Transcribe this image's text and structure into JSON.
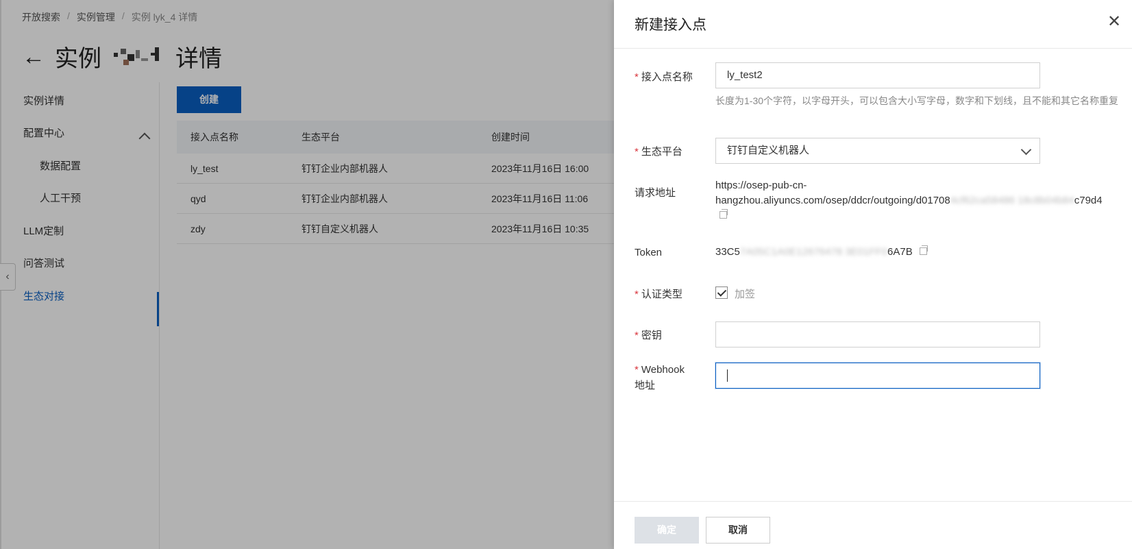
{
  "breadcrumb": {
    "items": [
      "开放搜索",
      "实例管理"
    ],
    "current": "实例 lyk_4 详情"
  },
  "header": {
    "title_prefix": "实例",
    "title_suffix": "详情"
  },
  "sidebar": {
    "items": [
      {
        "label": "实例详情"
      },
      {
        "label": "配置中心"
      },
      {
        "label": "数据配置"
      },
      {
        "label": "人工干预"
      },
      {
        "label": "LLM定制"
      },
      {
        "label": "问答测试"
      },
      {
        "label": "生态对接"
      }
    ]
  },
  "main": {
    "create_label": "创建",
    "columns": [
      "接入点名称",
      "生态平台",
      "创建时间"
    ],
    "rows": [
      {
        "name": "ly_test",
        "platform": "钉钉企业内部机器人",
        "time": "2023年11月16日 16:00"
      },
      {
        "name": "qyd",
        "platform": "钉钉企业内部机器人",
        "time": "2023年11月16日 11:06"
      },
      {
        "name": "zdy",
        "platform": "钉钉自定义机器人",
        "time": "2023年11月16日 10:35"
      }
    ]
  },
  "drawer": {
    "title": "新建接入点",
    "close_symbol": "✕",
    "fields": {
      "name_label": "接入点名称",
      "name_value": "ly_test2",
      "name_hint": "长度为1-30个字符，以字母开头，可以包含大小写字母，数字和下划线，且不能和其它名称重复",
      "platform_label": "生态平台",
      "platform_value": "钉钉自定义机器人",
      "url_label": "请求地址",
      "url_line1": "https://osep-pub-cn-",
      "url_line2_visible": "hangzhou.aliyuncs.com/osep/ddcr/outgoing/d01708",
      "url_line2_tail": "c79d4",
      "token_label": "Token",
      "token_start": "33C5",
      "token_end": "6A7B",
      "auth_label": "认证类型",
      "auth_option": "加签",
      "secret_label": "密钥",
      "webhook_label_1": "Webhook",
      "webhook_label_2": "地址"
    },
    "ok_label": "确定",
    "cancel_label": "取消"
  },
  "colors": {
    "primary": "#0a5fc2",
    "required": "#d9363e",
    "disabled": "#dde1e6"
  }
}
